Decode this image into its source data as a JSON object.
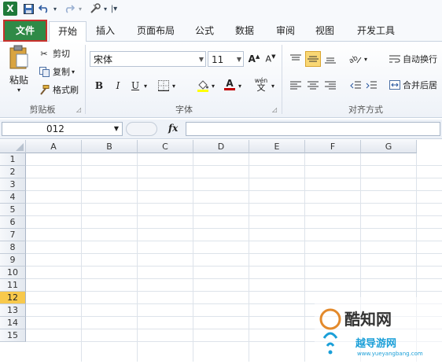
{
  "qat": {
    "logo": "X",
    "save_icon": "save-icon",
    "undo_icon": "undo-icon",
    "redo_icon": "redo-icon",
    "tools_icon": "tools-icon"
  },
  "tabs": [
    "文件",
    "开始",
    "插入",
    "页面布局",
    "公式",
    "数据",
    "审阅",
    "视图",
    "开发工具"
  ],
  "clipboard": {
    "paste": "粘贴",
    "cut": "剪切",
    "copy": "复制",
    "format_painter": "格式刷",
    "group": "剪贴板"
  },
  "font": {
    "name": "宋体",
    "size": "11",
    "bold": "B",
    "italic": "I",
    "underline": "U",
    "wen": "wén",
    "wen_char": "文",
    "group": "字体"
  },
  "alignment": {
    "wrap": "自动换行",
    "merge": "合并后居",
    "group": "对齐方式"
  },
  "formula_bar": {
    "name_box": "012",
    "fx": "fx"
  },
  "columns": [
    "A",
    "B",
    "C",
    "D",
    "E",
    "F",
    "G"
  ],
  "rows": [
    "1",
    "2",
    "3",
    "4",
    "5",
    "6",
    "7",
    "8",
    "9",
    "10",
    "11",
    "12",
    "13",
    "14",
    "15"
  ],
  "selected_row": "12",
  "watermark": {
    "text1": "酷知网",
    "text2": "越导游网",
    "url": "www.yueyangbang.com"
  },
  "colors": {
    "file_tab": "#2f8a47",
    "file_border": "#c9302c",
    "selected_row": "#f8c94c"
  }
}
